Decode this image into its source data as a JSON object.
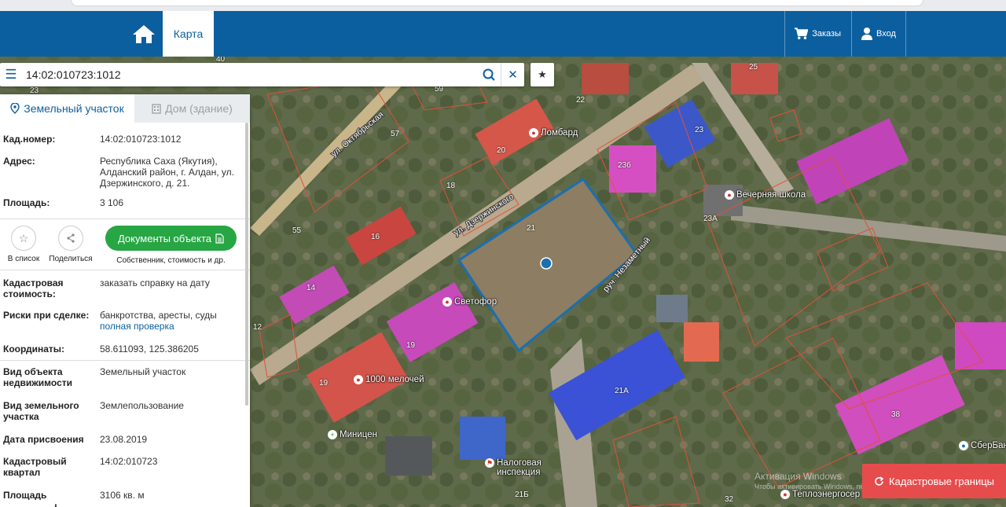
{
  "header": {
    "map_tab": "Карта",
    "orders": "Заказы",
    "login": "Вход",
    "brand_color": "#0c5f9e"
  },
  "search": {
    "value": "14:02:010723:1012",
    "menu_icon": "hamburger-icon",
    "search_icon": "magnifier-icon",
    "clear_icon": "close-icon",
    "favorite_icon": "star-icon"
  },
  "panel": {
    "tabs": [
      {
        "label": "Земельный участок",
        "icon": "pin-icon",
        "active": true
      },
      {
        "label": "Дом (здание)",
        "icon": "building-icon",
        "active": false
      }
    ],
    "rows_top": [
      {
        "label": "Кад.номер:",
        "value": "14:02:010723:1012",
        "link": true
      },
      {
        "label": "Адрес:",
        "value": "Республика Саха (Якутия), Алданский район, г. Алдан, ул. Дзержинского, д. 21.",
        "link": false
      },
      {
        "label": "Площадь:",
        "value": "3 106",
        "link": false
      }
    ],
    "actions": {
      "to_list": "В список",
      "share": "Поделиться",
      "documents": "Документы объекта",
      "documents_sub": "Собственник, стоимость и др."
    },
    "cadastral_value": {
      "label": "Кадастровая стоимость:",
      "value": "заказать справку на дату"
    },
    "risks": {
      "label": "Риски при сделке:",
      "value": "банкротства, аресты, суды",
      "link": "полная проверка"
    },
    "coords": {
      "label": "Координаты:",
      "value": "58.611093, 125.386205"
    },
    "rows_bottom": [
      {
        "label": "Вид объекта недвижимости",
        "value": "Земельный участок"
      },
      {
        "label": "Вид земельного участка",
        "value": "Землепользование"
      },
      {
        "label": "Дата присвоения",
        "value": "23.08.2019"
      },
      {
        "label": "Кадастровый квартал",
        "value": "14:02:010723"
      },
      {
        "label": "Площадь уточненная",
        "value": "3106 кв. м"
      }
    ]
  },
  "map": {
    "streets": [
      "ул. Дзержинского",
      "ул. Октябрьская",
      "руч. Незаметный"
    ],
    "pois": [
      "Ломбард",
      "Вечерняя школа",
      "Светофор",
      "1000 мелочей",
      "Миницен",
      "Налоговая инспекция",
      "Теплоэнергосер",
      "СберБан"
    ],
    "labels": [
      "59",
      "57",
      "22",
      "23",
      "25",
      "20",
      "23б",
      "18",
      "21",
      "16",
      "55",
      "23А",
      "14",
      "12",
      "19",
      "19",
      "21А",
      "38",
      "32",
      "21Б",
      "40",
      "23"
    ],
    "parcel_color": "#1a6fb0"
  },
  "overlay": {
    "cad_button": "Кадастровые границы",
    "watermark_line1": "Активация Windows",
    "watermark_line2": "Чтобы активировать Windows, перейдите в раздел \"Параметры\"."
  }
}
